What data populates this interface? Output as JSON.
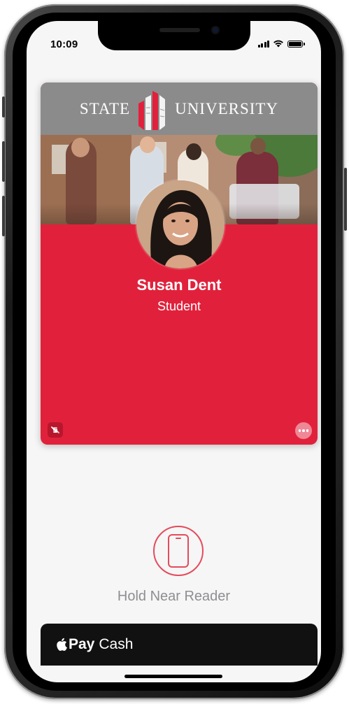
{
  "status_bar": {
    "time": "10:09",
    "icons": [
      "signal-icon",
      "wifi-icon",
      "battery-icon"
    ]
  },
  "card": {
    "header": {
      "left_word": "STATE",
      "right_word": "UNIVERSITY",
      "logo_icon": "university-logo-icon"
    },
    "name": "Susan Dent",
    "role": "Student",
    "background_color": "#e1213b",
    "header_color": "#8b8b8b"
  },
  "reader": {
    "label": "Hold Near Reader",
    "icon": "phone-reader-icon"
  },
  "apple_pay_cash": {
    "pay_label": "Pay",
    "cash_label": "Cash",
    "icon": "apple-icon"
  }
}
